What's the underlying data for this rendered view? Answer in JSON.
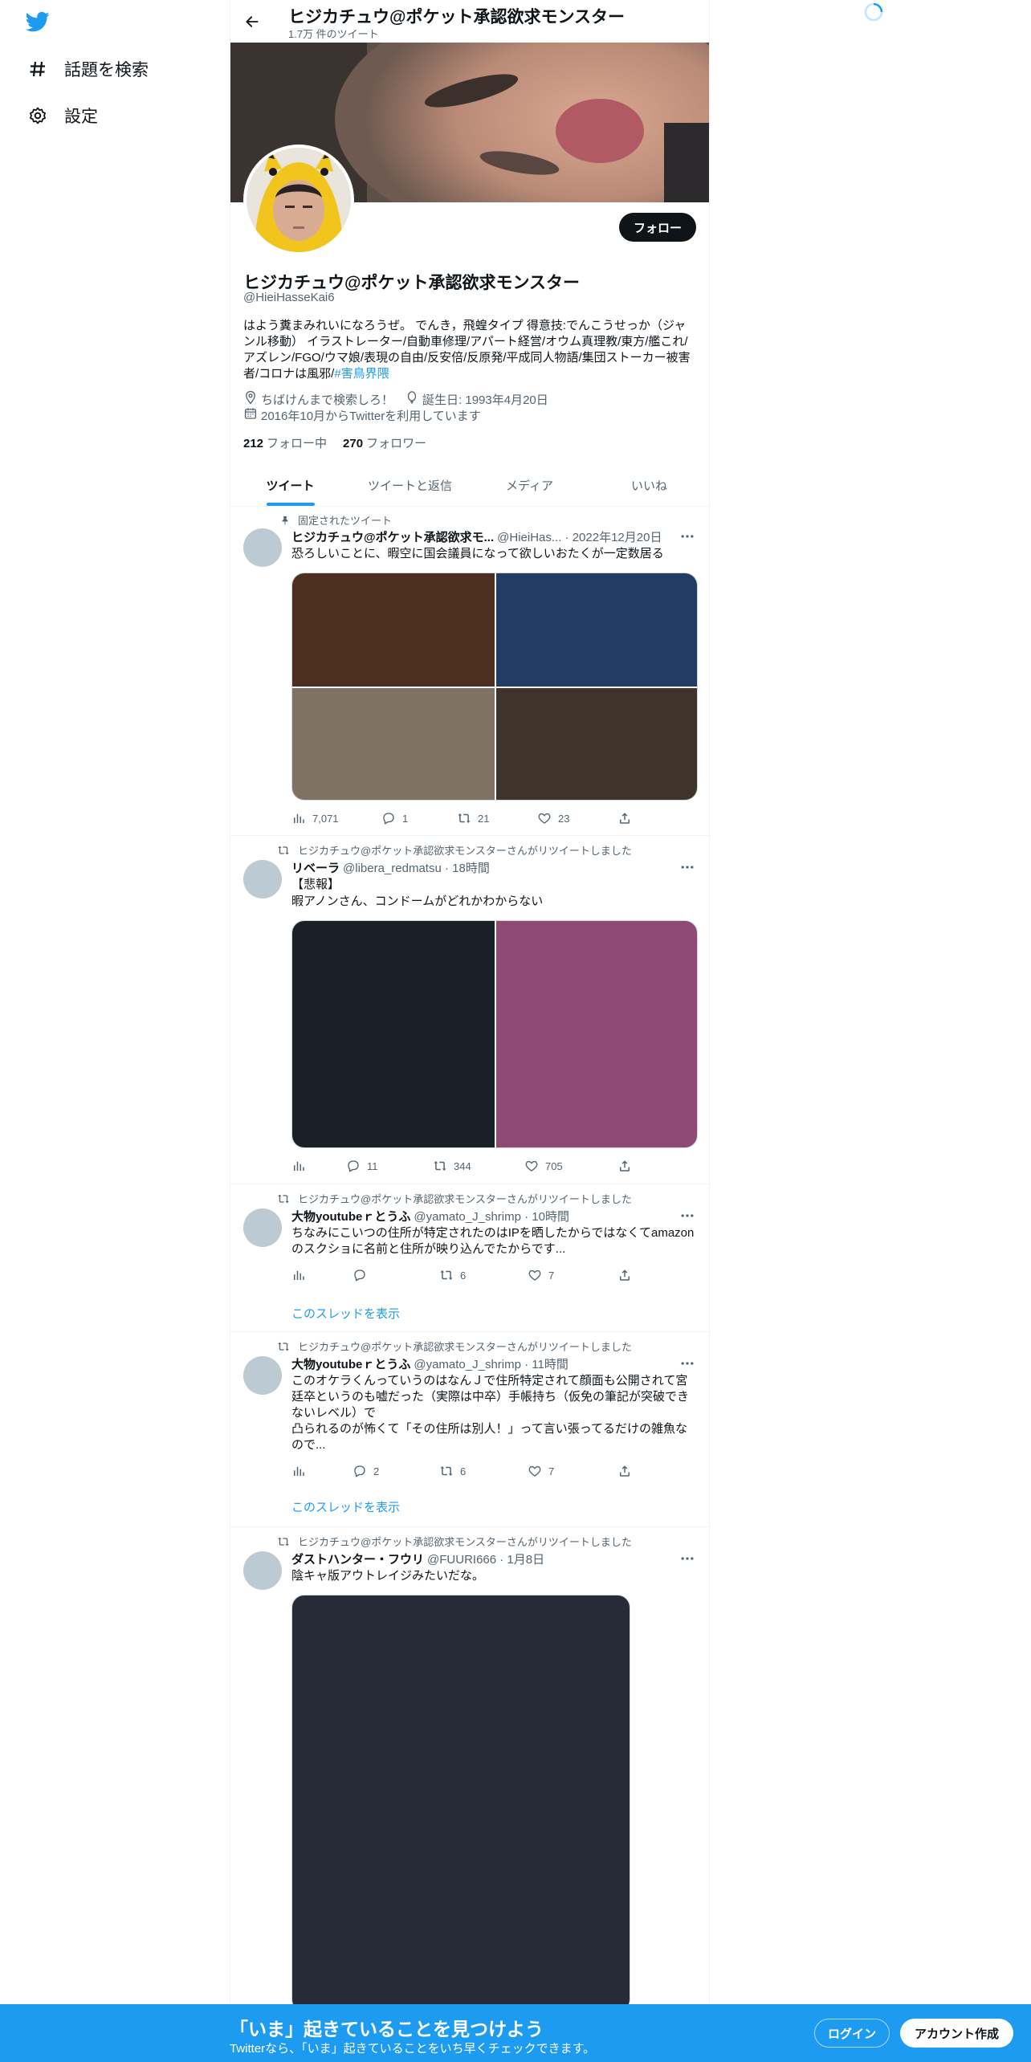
{
  "colors": {
    "accent": "#1d9bf0",
    "text": "#0f1419",
    "muted": "#536471"
  },
  "nav": {
    "items": [
      {
        "label": "話題を検索",
        "icon": "hashtag-icon"
      },
      {
        "label": "設定",
        "icon": "gear-icon"
      }
    ]
  },
  "header": {
    "title": "ヒジカチュウ@ポケット承認欲求モンスター",
    "subtitle": "1.7万 件のツイート"
  },
  "profile": {
    "follow_label": "フォロー",
    "name": "ヒジカチュウ@ポケット承認欲求モンスター",
    "handle": "@HieiHasseKai6",
    "bio": "はよう糞まみれいになろうぜ。 でんき，飛蝗タイプ 得意技:でんこうせっか（ジャンル移動） イラストレーター/自動車修理/アパート経営/オウム真理教/東方/艦これ/アズレン/FGO/ウマ娘/表現の自由/反安倍/反原発/平成同人物語/集団ストーカー被害者/コロナは風邪/",
    "bio_hashtag": "#害鳥界隈",
    "location": "ちばけんまで検索しろ！",
    "birthday": "誕生日: 1993年4月20日",
    "joined": "2016年10月からTwitterを利用しています",
    "following_count": "212",
    "following_label": "フォロー中",
    "followers_count": "270",
    "followers_label": "フォロワー"
  },
  "tabs": [
    "ツイート",
    "ツイートと返信",
    "メディア",
    "いいね"
  ],
  "tweets": [
    {
      "context": "固定されたツイート",
      "name": "ヒジカチュウ@ポケット承認欲求モ...",
      "meta": "@HieiHas... · 2022年12月20日",
      "text": "恐ろしいことに、暇空に国会議員になって欲しいおたくが一定数居る",
      "views": "7,071",
      "replies": "1",
      "retweets": "21",
      "likes": "23"
    },
    {
      "context": "ヒジカチュウ@ポケット承認欲求モンスターさんがリツイートしました",
      "name": "リベーラ",
      "meta": "@libera_redmatsu · 18時間",
      "text_line1": "【悲報】",
      "text_line2": "暇アノンさん、コンドームがどれかわからない",
      "views": "",
      "replies": "11",
      "retweets": "344",
      "likes": "705"
    },
    {
      "context": "ヒジカチュウ@ポケット承認欲求モンスターさんがリツイートしました",
      "name": "大物youtubeｒとうふ",
      "meta": "@yamato_J_shrimp · 10時間",
      "text": "ちなみにこいつの住所が特定されたのはIPを晒したからではなくてamazonのスクショに名前と住所が映り込んでたからです...",
      "views": "",
      "replies": "",
      "retweets": "6",
      "likes": "7",
      "thread": "このスレッドを表示"
    },
    {
      "context": "ヒジカチュウ@ポケット承認欲求モンスターさんがリツイートしました",
      "name": "大物youtubeｒとうふ",
      "meta": "@yamato_J_shrimp · 11時間",
      "text_line1": "このオケラくんっていうのはなんＪで住所特定されて顔面も公開されて宮廷卒というのも嘘だった（実際は中卒）手帳持ち（仮免の筆記が突破できないレベル）で",
      "text_line2": "凸られるのが怖くて「その住所は別人！」って言い張ってるだけの雑魚なので...",
      "views": "",
      "replies": "2",
      "retweets": "6",
      "likes": "7",
      "thread": "このスレッドを表示"
    },
    {
      "context": "ヒジカチュウ@ポケット承認欲求モンスターさんがリツイートしました",
      "name": "ダストハンター・フウリ",
      "meta": "@FUURI666 · 1月8日",
      "text": "陰キャ版アウトレイジみたいだな。"
    }
  ],
  "bottom_bar": {
    "title": "「いま」起きていることを見つけよう",
    "subtitle": "Twitterなら、「いま」起きていることをいち早くチェックできます。",
    "login": "ログイン",
    "signup": "アカウント作成"
  }
}
